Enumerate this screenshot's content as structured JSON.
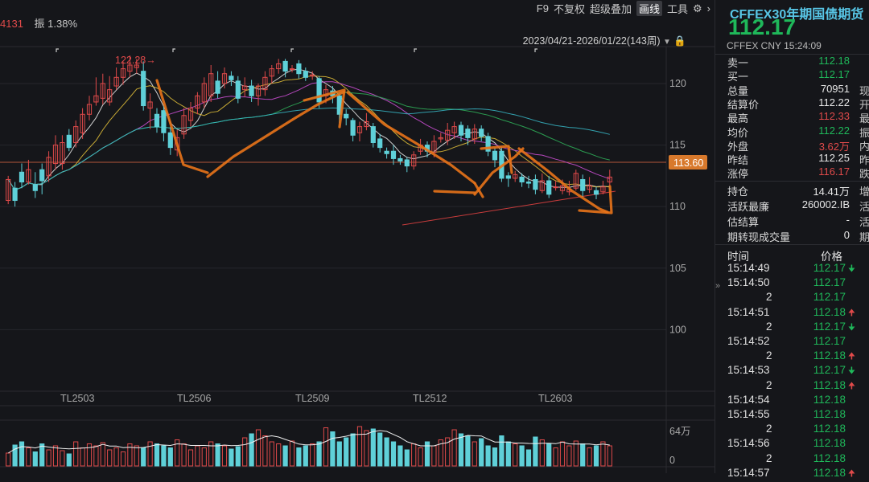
{
  "toolbar": {
    "left_value": "4131",
    "amplitude": "振 1.38%",
    "buttons": [
      "F9",
      "不复权",
      "超级叠加",
      "画线",
      "工具"
    ],
    "active_button": "画线",
    "date_range": "2023/04/21-2026/01/22(143周)"
  },
  "chart_data": {
    "type": "candlestick",
    "y_ticks": [
      "120",
      "115",
      "110",
      "105",
      "100"
    ],
    "ylim": [
      95,
      123
    ],
    "x_ticks": [
      "TL2503",
      "TL2506",
      "TL2509",
      "TL2512",
      "TL2603"
    ],
    "current_price_label": "113.60",
    "current_price": 113.6,
    "high_label": "122.28→",
    "volume_ticks": [
      "64万",
      "0"
    ],
    "candles": [
      [
        110.5,
        112.2,
        112.5,
        110.2
      ],
      [
        111.5,
        110.5,
        112.0,
        110.0
      ],
      [
        112.8,
        112.0,
        113.5,
        111.5
      ],
      [
        112.0,
        113.0,
        113.8,
        111.8
      ],
      [
        111.8,
        111.3,
        112.8,
        110.7
      ],
      [
        113.0,
        112.1,
        113.5,
        111.0
      ],
      [
        112.5,
        114.0,
        114.5,
        112.0
      ],
      [
        113.5,
        115.0,
        115.8,
        113.0
      ],
      [
        113.5,
        115.2,
        115.8,
        113.0
      ],
      [
        115.8,
        114.8,
        116.3,
        114.5
      ],
      [
        115.2,
        116.5,
        117.0,
        114.8
      ],
      [
        116.0,
        117.5,
        118.0,
        115.5
      ],
      [
        117.5,
        118.3,
        119.0,
        117.0
      ],
      [
        118.5,
        119.0,
        120.5,
        118.2
      ],
      [
        118.8,
        120.0,
        120.8,
        118.3
      ],
      [
        118.5,
        119.5,
        120.6,
        118.2
      ],
      [
        119.8,
        120.5,
        121.3,
        119.5
      ],
      [
        120.5,
        121.2,
        121.8,
        119.9
      ],
      [
        121.0,
        121.5,
        122.28,
        120.5
      ],
      [
        121.3,
        121.5,
        122.0,
        120.8
      ],
      [
        121.0,
        118.2,
        121.8,
        117.8
      ],
      [
        118.0,
        118.5,
        119.2,
        116.3
      ],
      [
        117.5,
        116.5,
        118.0,
        116.0
      ],
      [
        117.8,
        116.0,
        118.2,
        115.3
      ],
      [
        116.0,
        114.8,
        116.5,
        114.2
      ],
      [
        114.6,
        115.6,
        116.2,
        114.1
      ],
      [
        115.9,
        117.4,
        118.0,
        115.5
      ],
      [
        117.0,
        118.0,
        118.5,
        116.5
      ],
      [
        118.0,
        119.0,
        119.3,
        117.5
      ],
      [
        118.5,
        120.0,
        120.5,
        118.0
      ],
      [
        119.0,
        120.8,
        121.5,
        118.5
      ],
      [
        120.2,
        119.2,
        121.0,
        118.8
      ],
      [
        120.0,
        120.8,
        121.3,
        119.6
      ],
      [
        120.6,
        120.3,
        121.0,
        119.8
      ],
      [
        120.2,
        118.8,
        120.6,
        118.4
      ],
      [
        119.5,
        119.8,
        120.5,
        118.9
      ],
      [
        119.8,
        119.0,
        120.3,
        118.5
      ],
      [
        119.0,
        119.8,
        120.0,
        118.2
      ],
      [
        119.5,
        120.5,
        121.0,
        119.0
      ],
      [
        120.6,
        121.2,
        121.5,
        120.0
      ],
      [
        121.2,
        121.6,
        122.0,
        120.8
      ],
      [
        121.8,
        121.0,
        122.0,
        120.5
      ],
      [
        121.2,
        121.2,
        121.5,
        120.9
      ],
      [
        121.6,
        120.8,
        121.9,
        120.4
      ],
      [
        121.0,
        120.5,
        121.3,
        120.2
      ],
      [
        120.6,
        120.7,
        121.0,
        120.3
      ],
      [
        120.4,
        118.5,
        120.6,
        118.0
      ],
      [
        119.0,
        119.5,
        119.9,
        118.4
      ],
      [
        119.4,
        119.0,
        119.8,
        118.4
      ],
      [
        119.0,
        117.5,
        119.2,
        116.8
      ],
      [
        117.5,
        117.2,
        117.9,
        116.6
      ],
      [
        117.0,
        115.8,
        117.2,
        115.3
      ],
      [
        116.0,
        116.5,
        116.9,
        115.3
      ],
      [
        116.5,
        116.9,
        117.6,
        116.2
      ],
      [
        116.5,
        115.2,
        116.8,
        114.8
      ],
      [
        115.5,
        114.8,
        115.9,
        114.4
      ],
      [
        114.5,
        114.3,
        114.8,
        113.9
      ],
      [
        114.5,
        113.9,
        115.0,
        113.4
      ],
      [
        113.9,
        113.7,
        114.2,
        113.4
      ],
      [
        113.8,
        113.3,
        114.0,
        112.8
      ],
      [
        113.3,
        114.2,
        114.5,
        113.0
      ],
      [
        114.5,
        115.0,
        115.5,
        114.2
      ],
      [
        115.0,
        114.5,
        115.3,
        114.0
      ],
      [
        114.4,
        115.3,
        115.8,
        114.0
      ],
      [
        115.5,
        115.6,
        116.0,
        115.2
      ],
      [
        115.4,
        116.2,
        116.8,
        115.0
      ],
      [
        116.0,
        116.5,
        116.9,
        115.5
      ],
      [
        116.6,
        115.8,
        116.9,
        115.3
      ],
      [
        116.3,
        115.6,
        116.6,
        115.0
      ],
      [
        115.5,
        116.3,
        116.7,
        115.1
      ],
      [
        116.3,
        115.7,
        116.6,
        115.3
      ],
      [
        115.7,
        114.5,
        116.0,
        114.1
      ],
      [
        114.5,
        113.8,
        114.8,
        113.2
      ],
      [
        114.5,
        112.3,
        114.8,
        112.0
      ],
      [
        112.5,
        112.3,
        112.8,
        111.6
      ],
      [
        112.3,
        112.6,
        112.9,
        112.0
      ],
      [
        112.4,
        112.0,
        112.7,
        111.6
      ],
      [
        112.0,
        111.9,
        112.5,
        111.5
      ],
      [
        112.2,
        111.4,
        112.6,
        111.0
      ],
      [
        111.3,
        112.1,
        112.7,
        111.1
      ],
      [
        112.1,
        111.0,
        112.5,
        110.7
      ],
      [
        111.6,
        111.6,
        112.1,
        111.3
      ],
      [
        111.3,
        111.7,
        112.2,
        111.0
      ],
      [
        111.2,
        111.4,
        112.1,
        110.9
      ],
      [
        111.5,
        112.7,
        113.0,
        111.3
      ],
      [
        112.2,
        111.3,
        112.6,
        110.8
      ],
      [
        111.4,
        111.7,
        112.4,
        111.1
      ],
      [
        111.3,
        111.0,
        111.6,
        110.6
      ],
      [
        111.2,
        111.6,
        112.1,
        111.0
      ],
      [
        112.0,
        112.4,
        113.0,
        111.7
      ]
    ],
    "volumes": [
      0.32,
      0.52,
      0.6,
      0.45,
      0.35,
      0.55,
      0.4,
      0.5,
      0.38,
      0.3,
      0.6,
      0.45,
      0.55,
      0.5,
      0.58,
      0.4,
      0.45,
      0.35,
      0.55,
      0.5,
      0.45,
      0.6,
      0.55,
      0.5,
      0.45,
      0.65,
      0.55,
      0.4,
      0.5,
      0.45,
      0.6,
      0.55,
      0.5,
      0.42,
      0.48,
      0.7,
      0.8,
      0.9,
      0.75,
      0.6,
      0.55,
      0.5,
      0.62,
      0.45,
      0.5,
      0.55,
      0.6,
      0.95,
      0.85,
      0.6,
      0.7,
      0.8,
      0.98,
      0.88,
      0.92,
      0.82,
      0.7,
      0.6,
      0.5,
      0.4,
      0.55,
      0.45,
      0.6,
      0.5,
      0.65,
      0.7,
      0.9,
      0.8,
      0.75,
      0.6,
      0.68,
      0.5,
      0.45,
      0.75,
      0.6,
      0.55,
      0.5,
      0.4,
      0.72,
      0.65,
      0.55,
      0.45,
      0.6,
      0.5,
      0.62,
      0.55,
      0.45,
      0.5,
      0.6,
      0.5
    ]
  },
  "panel": {
    "title": "CFFEX30年期国债期货",
    "price": "112.17",
    "subtitle": "CFFEX  CNY  15:24:09",
    "quotes": [
      {
        "k": "卖一",
        "v": "112.18",
        "c": "green",
        "x": ""
      },
      {
        "k": "买一",
        "v": "112.17",
        "c": "green",
        "x": ""
      },
      {
        "k": "总量",
        "v": "70951",
        "c": "white",
        "x": "现"
      },
      {
        "k": "结算价",
        "v": "112.22",
        "c": "white",
        "x": "开"
      },
      {
        "k": "最高",
        "v": "112.33",
        "c": "red",
        "x": "最"
      },
      {
        "k": "均价",
        "v": "112.22",
        "c": "green",
        "x": "振"
      },
      {
        "k": "外盘",
        "v": "3.62万",
        "c": "red",
        "x": "内"
      },
      {
        "k": "昨结",
        "v": "112.25",
        "c": "white",
        "x": "昨"
      },
      {
        "k": "涨停",
        "v": "116.17",
        "c": "red",
        "x": "跌"
      }
    ],
    "info": [
      {
        "k": "持仓",
        "v": "14.41万",
        "x": "增"
      },
      {
        "k": "活跃最廉",
        "v": "260002.IB",
        "x": "活"
      },
      {
        "k": "估结算",
        "v": "-",
        "x": "活"
      },
      {
        "k": "期转现成交量",
        "v": "0",
        "x": "期"
      }
    ],
    "trades_header": {
      "time": "时间",
      "price": "价格"
    },
    "trades": [
      {
        "t": "15:14:49",
        "q": "",
        "p": "112.17",
        "a": "down"
      },
      {
        "t": "15:14:50",
        "q": "",
        "p": "112.17",
        "a": ""
      },
      {
        "t": "",
        "q": "2",
        "p": "112.17",
        "a": ""
      },
      {
        "t": "15:14:51",
        "q": "",
        "p": "112.18",
        "a": "up"
      },
      {
        "t": "",
        "q": "2",
        "p": "112.17",
        "a": "down"
      },
      {
        "t": "15:14:52",
        "q": "",
        "p": "112.17",
        "a": ""
      },
      {
        "t": "",
        "q": "2",
        "p": "112.18",
        "a": "up"
      },
      {
        "t": "15:14:53",
        "q": "",
        "p": "112.17",
        "a": "down"
      },
      {
        "t": "",
        "q": "2",
        "p": "112.18",
        "a": "up"
      },
      {
        "t": "15:14:54",
        "q": "",
        "p": "112.18",
        "a": ""
      },
      {
        "t": "15:14:55",
        "q": "",
        "p": "112.18",
        "a": ""
      },
      {
        "t": "",
        "q": "2",
        "p": "112.18",
        "a": ""
      },
      {
        "t": "15:14:56",
        "q": "",
        "p": "112.18",
        "a": ""
      },
      {
        "t": "",
        "q": "2",
        "p": "112.18",
        "a": ""
      },
      {
        "t": "15:14:57",
        "q": "",
        "p": "112.18",
        "a": "up"
      }
    ]
  },
  "colors": {
    "up": "#e04a4a",
    "down": "#5fd0d8",
    "green": "#1fb85a",
    "annotation": "#e8731a"
  }
}
